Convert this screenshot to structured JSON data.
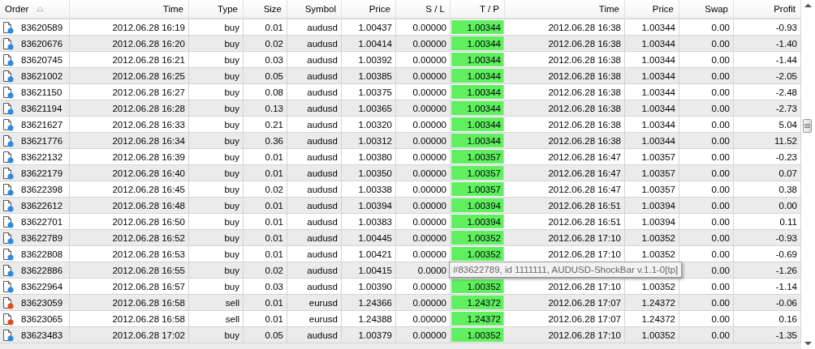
{
  "table": {
    "columns": [
      {
        "label": "Order",
        "sorted": true
      },
      {
        "label": "Time",
        "sorted": false
      },
      {
        "label": "Type",
        "sorted": false
      },
      {
        "label": "Size",
        "sorted": false
      },
      {
        "label": "Symbol",
        "sorted": false
      },
      {
        "label": "Price",
        "sorted": false
      },
      {
        "label": "S / L",
        "sorted": false
      },
      {
        "label": "T / P",
        "sorted": false
      },
      {
        "label": "Time",
        "sorted": false
      },
      {
        "label": "Price",
        "sorted": false
      },
      {
        "label": "Swap",
        "sorted": false
      },
      {
        "label": "Profit",
        "sorted": false
      }
    ],
    "rows": [
      {
        "kind": "buy",
        "cells": [
          "83620589",
          "2012.06.28 16:19",
          "buy",
          "0.01",
          "audusd",
          "1.00437",
          "0.00000",
          "1.00344",
          "2012.06.28 16:38",
          "1.00344",
          "0.00",
          "-0.93"
        ]
      },
      {
        "kind": "buy",
        "cells": [
          "83620676",
          "2012.06.28 16:20",
          "buy",
          "0.02",
          "audusd",
          "1.00414",
          "0.00000",
          "1.00344",
          "2012.06.28 16:38",
          "1.00344",
          "0.00",
          "-1.40"
        ]
      },
      {
        "kind": "buy",
        "cells": [
          "83620745",
          "2012.06.28 16:21",
          "buy",
          "0.03",
          "audusd",
          "1.00392",
          "0.00000",
          "1.00344",
          "2012.06.28 16:38",
          "1.00344",
          "0.00",
          "-1.44"
        ]
      },
      {
        "kind": "buy",
        "cells": [
          "83621002",
          "2012.06.28 16:25",
          "buy",
          "0.05",
          "audusd",
          "1.00385",
          "0.00000",
          "1.00344",
          "2012.06.28 16:38",
          "1.00344",
          "0.00",
          "-2.05"
        ]
      },
      {
        "kind": "buy",
        "cells": [
          "83621150",
          "2012.06.28 16:27",
          "buy",
          "0.08",
          "audusd",
          "1.00375",
          "0.00000",
          "1.00344",
          "2012.06.28 16:38",
          "1.00344",
          "0.00",
          "-2.48"
        ]
      },
      {
        "kind": "buy",
        "cells": [
          "83621194",
          "2012.06.28 16:28",
          "buy",
          "0.13",
          "audusd",
          "1.00365",
          "0.00000",
          "1.00344",
          "2012.06.28 16:38",
          "1.00344",
          "0.00",
          "-2.73"
        ]
      },
      {
        "kind": "buy",
        "cells": [
          "83621627",
          "2012.06.28 16:33",
          "buy",
          "0.21",
          "audusd",
          "1.00320",
          "0.00000",
          "1.00344",
          "2012.06.28 16:38",
          "1.00344",
          "0.00",
          "5.04"
        ]
      },
      {
        "kind": "buy",
        "cells": [
          "83621776",
          "2012.06.28 16:34",
          "buy",
          "0.36",
          "audusd",
          "1.00312",
          "0.00000",
          "1.00344",
          "2012.06.28 16:38",
          "1.00344",
          "0.00",
          "11.52"
        ]
      },
      {
        "kind": "buy",
        "cells": [
          "83622132",
          "2012.06.28 16:39",
          "buy",
          "0.01",
          "audusd",
          "1.00380",
          "0.00000",
          "1.00357",
          "2012.06.28 16:47",
          "1.00357",
          "0.00",
          "-0.23"
        ]
      },
      {
        "kind": "buy",
        "cells": [
          "83622179",
          "2012.06.28 16:40",
          "buy",
          "0.01",
          "audusd",
          "1.00350",
          "0.00000",
          "1.00357",
          "2012.06.28 16:47",
          "1.00357",
          "0.00",
          "0.07"
        ]
      },
      {
        "kind": "buy",
        "cells": [
          "83622398",
          "2012.06.28 16:45",
          "buy",
          "0.02",
          "audusd",
          "1.00338",
          "0.00000",
          "1.00357",
          "2012.06.28 16:47",
          "1.00357",
          "0.00",
          "0.38"
        ]
      },
      {
        "kind": "buy",
        "cells": [
          "83622612",
          "2012.06.28 16:48",
          "buy",
          "0.01",
          "audusd",
          "1.00394",
          "0.00000",
          "1.00394",
          "2012.06.28 16:51",
          "1.00394",
          "0.00",
          "0.00"
        ]
      },
      {
        "kind": "buy",
        "cells": [
          "83622701",
          "2012.06.28 16:50",
          "buy",
          "0.01",
          "audusd",
          "1.00383",
          "0.00000",
          "1.00394",
          "2012.06.28 16:51",
          "1.00394",
          "0.00",
          "0.11"
        ]
      },
      {
        "kind": "buy",
        "cells": [
          "83622789",
          "2012.06.28 16:52",
          "buy",
          "0.01",
          "audusd",
          "1.00445",
          "0.00000",
          "1.00352",
          "2012.06.28 17:10",
          "1.00352",
          "0.00",
          "-0.93"
        ]
      },
      {
        "kind": "buy",
        "cells": [
          "83622808",
          "2012.06.28 16:53",
          "buy",
          "0.01",
          "audusd",
          "1.00421",
          "0.00000",
          "1.00352",
          "2012.06.28 17:10",
          "1.00352",
          "0.00",
          "-0.69"
        ]
      },
      {
        "kind": "buy",
        "cells": [
          "83622886",
          "2012.06.28 16:55",
          "buy",
          "0.02",
          "audusd",
          "1.00415",
          "0.0000",
          null,
          null,
          null,
          "0.00",
          "-1.26"
        ]
      },
      {
        "kind": "buy",
        "cells": [
          "83622964",
          "2012.06.28 16:57",
          "buy",
          "0.03",
          "audusd",
          "1.00390",
          "0.00000",
          "1.00352",
          "2012.06.28 17:10",
          "1.00352",
          "0.00",
          "-1.14"
        ]
      },
      {
        "kind": "sell",
        "cells": [
          "83623059",
          "2012.06.28 16:58",
          "sell",
          "0.01",
          "eurusd",
          "1.24366",
          "0.00000",
          "1.24372",
          "2012.06.28 17:07",
          "1.24372",
          "0.00",
          "-0.06"
        ]
      },
      {
        "kind": "sell",
        "cells": [
          "83623065",
          "2012.06.28 16:58",
          "sell",
          "0.01",
          "eurusd",
          "1.24388",
          "0.00000",
          "1.24372",
          "2012.06.28 17:07",
          "1.24372",
          "0.00",
          "0.16"
        ]
      },
      {
        "kind": "buy",
        "cells": [
          "83623483",
          "2012.06.28 17:02",
          "buy",
          "0.05",
          "audusd",
          "1.00379",
          "0.00000",
          "1.00352",
          "2012.06.28 17:10",
          "1.00352",
          "0.00",
          "-1.35"
        ]
      }
    ]
  },
  "tooltip": {
    "text": "#83622789, id 1111111, AUDUSD-ShockBar v.1.1-0[tp]"
  }
}
